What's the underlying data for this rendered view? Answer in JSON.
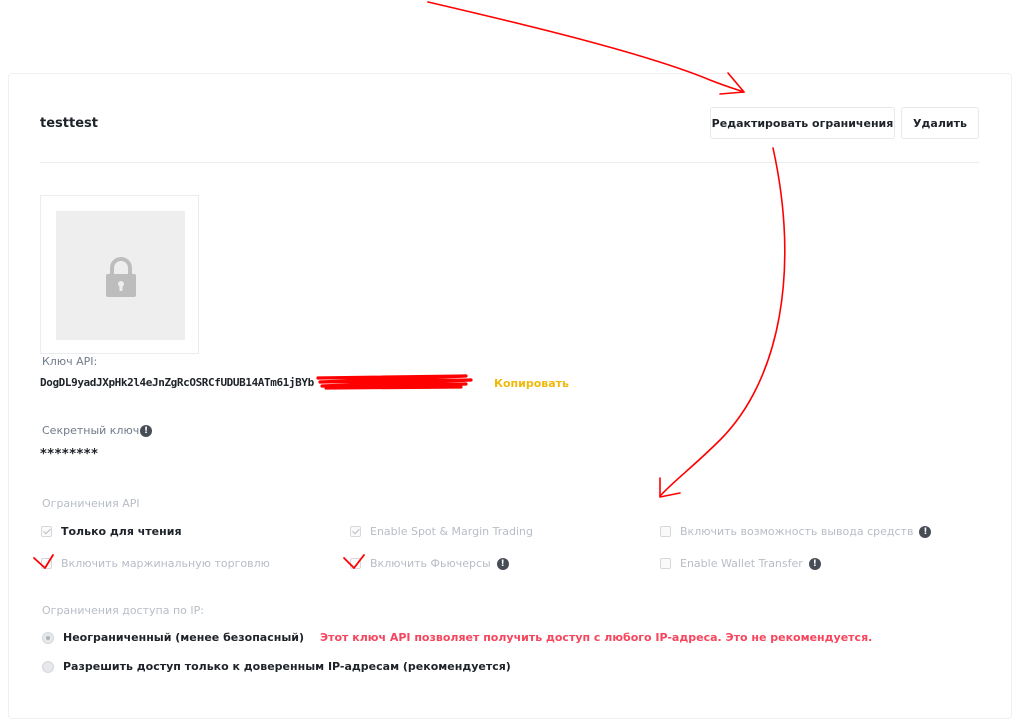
{
  "key": {
    "name": "testtest",
    "edit_label": "Редактировать ограничения",
    "delete_label": "Удалить"
  },
  "api_key": {
    "label": "Ключ API:",
    "value": "DogDL9yadJXpHk2l4eJnZgRcOSRCfUDUB14ATm61jBYb",
    "copy_label": "Копировать"
  },
  "secret": {
    "label": "Секретный ключ:",
    "value": "********",
    "info_glyph": "!"
  },
  "restrictions": {
    "label": "Ограничения API",
    "options": [
      {
        "label": "Только для чтения",
        "checked": true
      },
      {
        "label": "Enable Spot & Margin Trading",
        "checked": true
      },
      {
        "label": "Включить возможность вывода средств",
        "checked": false
      },
      {
        "label": "Включить маржинальную торговлю",
        "checked": false
      },
      {
        "label": "Включить Фьючерсы",
        "checked": false
      },
      {
        "label": "Enable Wallet Transfer",
        "checked": false
      }
    ]
  },
  "ip_access": {
    "label": "Ограничения доступа по IP:",
    "unrestricted_label": "Неограниченный (менее безопасный)",
    "unrestricted_warning": "Этот ключ API позволяет получить доступ с любого IP-адреса. Это не рекомендуется.",
    "trusted_label": "Разрешить доступ только к доверенным IP-адресам (рекомендуется)",
    "selected": "unrestricted"
  },
  "colors": {
    "accent": "#f0b90b",
    "warning": "#f6465d",
    "annotation": "#ff0000"
  },
  "icons": {
    "qr_placeholder": "lock-icon",
    "info": "info-icon"
  }
}
